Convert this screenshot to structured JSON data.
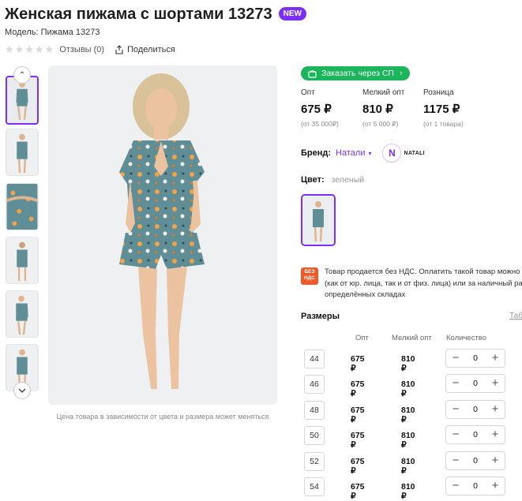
{
  "product": {
    "title": "Женская пижама с шортами 13273",
    "badge": "NEW",
    "model": "Модель: Пижама 13273",
    "reviews": "Отзывы (0)",
    "share": "Поделиться",
    "rating_stars": 0
  },
  "gallery": {
    "caption": "Цена товара в зависимости от цвета и размера может меняться",
    "thumb_count": 6,
    "selected_thumb": 0
  },
  "order_button": "Заказать через СП",
  "prices": [
    {
      "label": "Опт",
      "value": "675 ₽",
      "sub": "(от 35 000₽)"
    },
    {
      "label": "Мелкий опт",
      "value": "810 ₽",
      "sub": "(от 5 000 ₽)"
    },
    {
      "label": "Розница",
      "value": "1175 ₽",
      "sub": "(от 1 товара)"
    }
  ],
  "brand": {
    "label": "Бренд:",
    "name": "Натали",
    "logo_letter": "N",
    "logo_text": "NATALI"
  },
  "color": {
    "label": "Цвет:",
    "value": "зеленый"
  },
  "vat": {
    "icon_line1": "БЕЗ",
    "icon_line2": "НДС",
    "line1": "Товар продается без НДС. Оплатить такой товар можно т",
    "line2": "(как от юр. лица, так и от физ. лица) или за наличный расч",
    "line3": "определённых складах"
  },
  "sizes": {
    "title": "Размеры",
    "table_link": "Таб",
    "headers": {
      "opt": "Опт",
      "small_opt": "Мелкий опт",
      "qty": "Количество"
    },
    "rows": [
      {
        "size": "44",
        "opt": "675 ₽",
        "small_opt": "810 ₽",
        "qty": "0"
      },
      {
        "size": "46",
        "opt": "675 ₽",
        "small_opt": "810 ₽",
        "qty": "0"
      },
      {
        "size": "48",
        "opt": "675 ₽",
        "small_opt": "810 ₽",
        "qty": "0"
      },
      {
        "size": "50",
        "opt": "675 ₽",
        "small_opt": "810 ₽",
        "qty": "0"
      },
      {
        "size": "52",
        "opt": "675 ₽",
        "small_opt": "810 ₽",
        "qty": "0"
      },
      {
        "size": "54",
        "opt": "675 ₽",
        "small_opt": "810 ₽",
        "qty": "0"
      }
    ]
  },
  "colors": {
    "accent": "#7b2ff7",
    "order_green": "#1bb55c",
    "vat_orange": "#f05a28",
    "fabric": "#5f8e97"
  },
  "icons": {
    "star": "star-icon",
    "share": "share-icon",
    "cart": "cart-icon",
    "chevron_up": "chevron-up-icon",
    "chevron_down": "chevron-down-icon",
    "minus": "minus-icon",
    "plus": "plus-icon"
  }
}
